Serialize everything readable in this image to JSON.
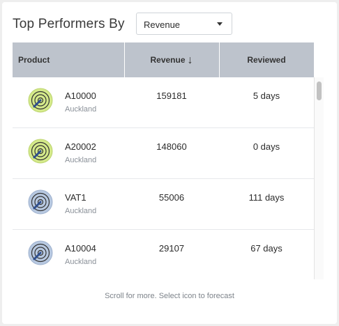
{
  "header": {
    "title": "Top Performers By",
    "metric_select": {
      "value": "Revenue"
    }
  },
  "table": {
    "columns": {
      "product": "Product",
      "revenue": "Revenue",
      "reviewed": "Reviewed"
    },
    "sort_arrow": "↓",
    "rows": [
      {
        "name": "A10000",
        "location": "Auckland",
        "revenue": "159181",
        "reviewed": "5 days",
        "icon": "radar-icon",
        "icon_color": "#d4e98a"
      },
      {
        "name": "A20002",
        "location": "Auckland",
        "revenue": "148060",
        "reviewed": "0 days",
        "icon": "radar-icon",
        "icon_color": "#d4e98a"
      },
      {
        "name": "VAT1",
        "location": "Auckland",
        "revenue": "55006",
        "reviewed": "111 days",
        "icon": "radar-icon",
        "icon_color": "#b7c8e0"
      },
      {
        "name": "A10004",
        "location": "Auckland",
        "revenue": "29107",
        "reviewed": "67 days",
        "icon": "radar-icon",
        "icon_color": "#b7c8e0"
      }
    ]
  },
  "footer": {
    "hint": "Scroll for more. Select icon to forecast"
  }
}
